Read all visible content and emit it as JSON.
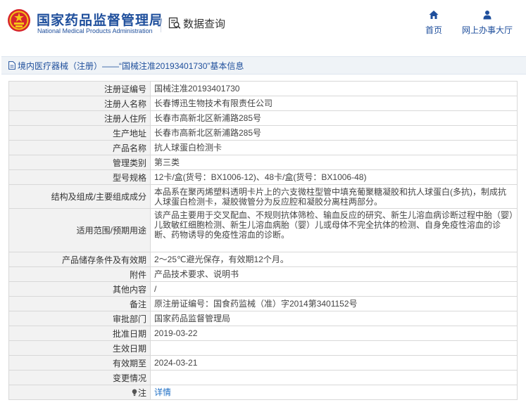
{
  "header": {
    "site_name": "国家药品监督管理局",
    "site_name_en": "National Medical Products Administration",
    "data_query_label": "数据查询",
    "nav": [
      {
        "label": "首页",
        "icon": "home-icon"
      },
      {
        "label": "网上办事大厅",
        "icon": "user-icon"
      }
    ]
  },
  "breadcrumb": {
    "text": "境内医疗器械（注册）——“国械注准20193401730”基本信息",
    "icon": "document-icon"
  },
  "record": {
    "rows": [
      {
        "label": "注册证编号",
        "value": "国械注准20193401730"
      },
      {
        "label": "注册人名称",
        "value": "长春博迅生物技术有限责任公司"
      },
      {
        "label": "注册人住所",
        "value": "长春市高新北区新浦路285号"
      },
      {
        "label": "生产地址",
        "value": "长春市高新北区新浦路285号"
      },
      {
        "label": "产品名称",
        "value": "抗人球蛋白检测卡"
      },
      {
        "label": "管理类别",
        "value": "第三类"
      },
      {
        "label": "型号规格",
        "value": "12卡/盒(货号：BX1006-12)、48卡/盒(货号：BX1006-48)"
      },
      {
        "label": "结构及组成/主要组成成分",
        "value": "本品系在聚丙烯塑料透明卡片上的六支微柱型管中填充葡聚糖凝胶和抗人球蛋白(多抗)，制成抗人球蛋白检测卡，凝胶微管分为反应腔和凝胶分离柱两部分。"
      },
      {
        "label": "适用范围/预期用途",
        "value": "该产品主要用于交叉配血、不规则抗体筛检、输血反应的研究、新生儿溶血病诊断过程中胎（婴）儿致敏红细胞检测、新生儿溶血病胎（婴）儿或母体不完全抗体的检测、自身免疫性溶血的诊断、药物诱导的免疫性溶血的诊断。"
      },
      {
        "label": "产品储存条件及有效期",
        "value": "2～25℃避光保存，有效期12个月。"
      },
      {
        "label": "附件",
        "value": "产品技术要求、说明书"
      },
      {
        "label": "其他内容",
        "value": "/"
      },
      {
        "label": "备注",
        "value": "原注册证编号：国食药监械（准）字2014第3401152号"
      },
      {
        "label": "审批部门",
        "value": "国家药品监督管理局"
      },
      {
        "label": "批准日期",
        "value": "2019-03-22"
      },
      {
        "label": "生效日期",
        "value": ""
      },
      {
        "label": "有效期至",
        "value": "2024-03-21"
      },
      {
        "label": "变更情况",
        "value": ""
      }
    ],
    "note": {
      "label": "注",
      "link_text": "详情"
    }
  },
  "colors": {
    "brand_blue": "#1f4f9c",
    "link_blue": "#1f6fc5",
    "label_bg": "#f2f2f2",
    "breadcrumb_bg": "#eff3f7"
  }
}
